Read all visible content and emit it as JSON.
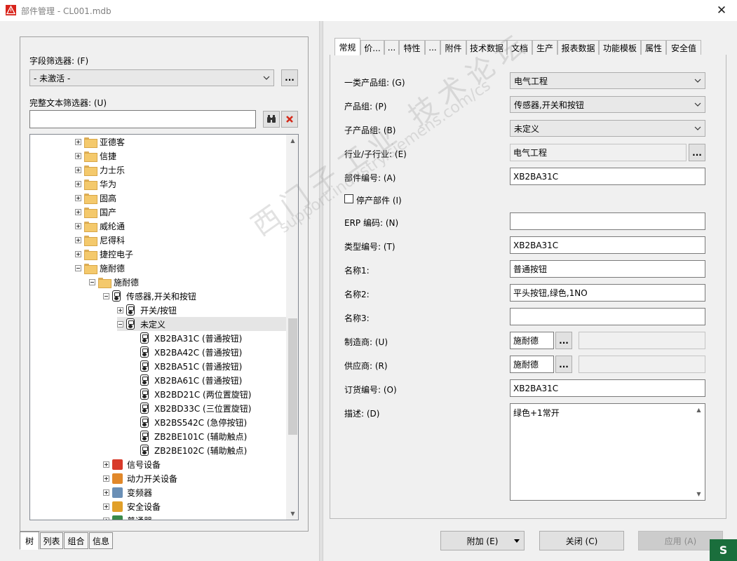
{
  "window": {
    "title": "部件管理 - CL001.mdb"
  },
  "left": {
    "field_filter_label": "字段筛选器: (F)",
    "field_filter_value": "- 未激活 -",
    "text_filter_label": "完整文本筛选器: (U)",
    "text_filter_value": "",
    "browse_label": "...",
    "tree": [
      {
        "label": "亚德客",
        "level": 0,
        "expander": "plus",
        "icon": "folder"
      },
      {
        "label": "信捷",
        "level": 0,
        "expander": "plus",
        "icon": "folder"
      },
      {
        "label": "力士乐",
        "level": 0,
        "expander": "plus",
        "icon": "folder"
      },
      {
        "label": "华为",
        "level": 0,
        "expander": "plus",
        "icon": "folder"
      },
      {
        "label": "固高",
        "level": 0,
        "expander": "plus",
        "icon": "folder"
      },
      {
        "label": "国产",
        "level": 0,
        "expander": "plus",
        "icon": "folder"
      },
      {
        "label": "威纶通",
        "level": 0,
        "expander": "plus",
        "icon": "folder"
      },
      {
        "label": "尼得科",
        "level": 0,
        "expander": "plus",
        "icon": "folder"
      },
      {
        "label": "捷控电子",
        "level": 0,
        "expander": "plus",
        "icon": "folder"
      },
      {
        "label": "施耐德",
        "level": 0,
        "expander": "minus",
        "icon": "folder"
      },
      {
        "label": "施耐德",
        "level": 1,
        "expander": "minus",
        "icon": "folder"
      },
      {
        "label": "传感器,开关和按钮",
        "level": 2,
        "expander": "minus",
        "icon": "pushbutton"
      },
      {
        "label": "开关/按钮",
        "level": 3,
        "expander": "plus",
        "icon": "pushbutton"
      },
      {
        "label": "未定义",
        "level": 3,
        "expander": "minus",
        "icon": "pushbutton",
        "selected": true
      },
      {
        "label": "XB2BA31C (普通按钮)",
        "level": 4,
        "expander": "none",
        "icon": "pushbutton"
      },
      {
        "label": "XB2BA42C (普通按钮)",
        "level": 4,
        "expander": "none",
        "icon": "pushbutton"
      },
      {
        "label": "XB2BA51C (普通按钮)",
        "level": 4,
        "expander": "none",
        "icon": "pushbutton"
      },
      {
        "label": "XB2BA61C (普通按钮)",
        "level": 4,
        "expander": "none",
        "icon": "pushbutton"
      },
      {
        "label": "XB2BD21C (两位置旋钮)",
        "level": 4,
        "expander": "none",
        "icon": "pushbutton"
      },
      {
        "label": "XB2BD33C (三位置旋钮)",
        "level": 4,
        "expander": "none",
        "icon": "pushbutton"
      },
      {
        "label": "XB2BS542C (急停按钮)",
        "level": 4,
        "expander": "none",
        "icon": "pushbutton"
      },
      {
        "label": "ZB2BE101C (辅助触点)",
        "level": 4,
        "expander": "none",
        "icon": "pushbutton"
      },
      {
        "label": "ZB2BE102C (辅助触点)",
        "level": 4,
        "expander": "none",
        "icon": "pushbutton"
      },
      {
        "label": "信号设备",
        "level": 2,
        "expander": "plus",
        "icon": "signal"
      },
      {
        "label": "动力开关设备",
        "level": 2,
        "expander": "plus",
        "icon": "power"
      },
      {
        "label": "变频器",
        "level": 2,
        "expander": "plus",
        "icon": "inverter"
      },
      {
        "label": "安全设备",
        "level": 2,
        "expander": "plus",
        "icon": "safety"
      },
      {
        "label": "普通器",
        "level": 2,
        "expander": "plus",
        "icon": "misc"
      }
    ],
    "bottom_tabs": [
      "树",
      "列表",
      "组合",
      "信息"
    ]
  },
  "tabs": [
    "常规",
    "价...",
    "...",
    "特性",
    "...",
    "附件",
    "技术数据",
    "文档",
    "生产",
    "报表数据",
    "功能模板",
    "属性",
    "安全值"
  ],
  "form": {
    "product_group1_label": "一类产品组: (G)",
    "product_group1_value": "电气工程",
    "product_group_label": "产品组: (P)",
    "product_group_value": "传感器,开关和按钮",
    "sub_group_label": "子产品组: (B)",
    "sub_group_value": "未定义",
    "industry_label": "行业/子行业: (E)",
    "industry_value": "电气工程",
    "part_no_label": "部件编号: (A)",
    "part_no_value": "XB2BA31C",
    "discontinued_label": "停产部件 (I)",
    "erp_label": "ERP 编码: (N)",
    "erp_value": "",
    "type_no_label": "类型编号: (T)",
    "type_no_value": "XB2BA31C",
    "name1_label": "名称1:",
    "name1_value": "普通按钮",
    "name2_label": "名称2:",
    "name2_value": "平头按钮,绿色,1NO",
    "name3_label": "名称3:",
    "name3_value": "",
    "manufacturer_label": "制造商: (U)",
    "manufacturer_value": "施耐德",
    "supplier_label": "供应商: (R)",
    "supplier_value": "施耐德",
    "order_no_label": "订货编号: (O)",
    "order_no_value": "XB2BA31C",
    "desc_label": "描述: (D)",
    "desc_value": "绿色+1常开"
  },
  "buttons": {
    "attach": "附加 (E)",
    "close": "关闭 (C)",
    "apply": "应用 (A)"
  },
  "watermark": {
    "line1": "西门子工业 技术论坛",
    "line2": "support.industry.siemens.com/cs"
  },
  "colors": {
    "tab_active_bg": "#ffffff",
    "window_bg": "#f0f0f0",
    "selected_row": "#e5e5e5"
  }
}
